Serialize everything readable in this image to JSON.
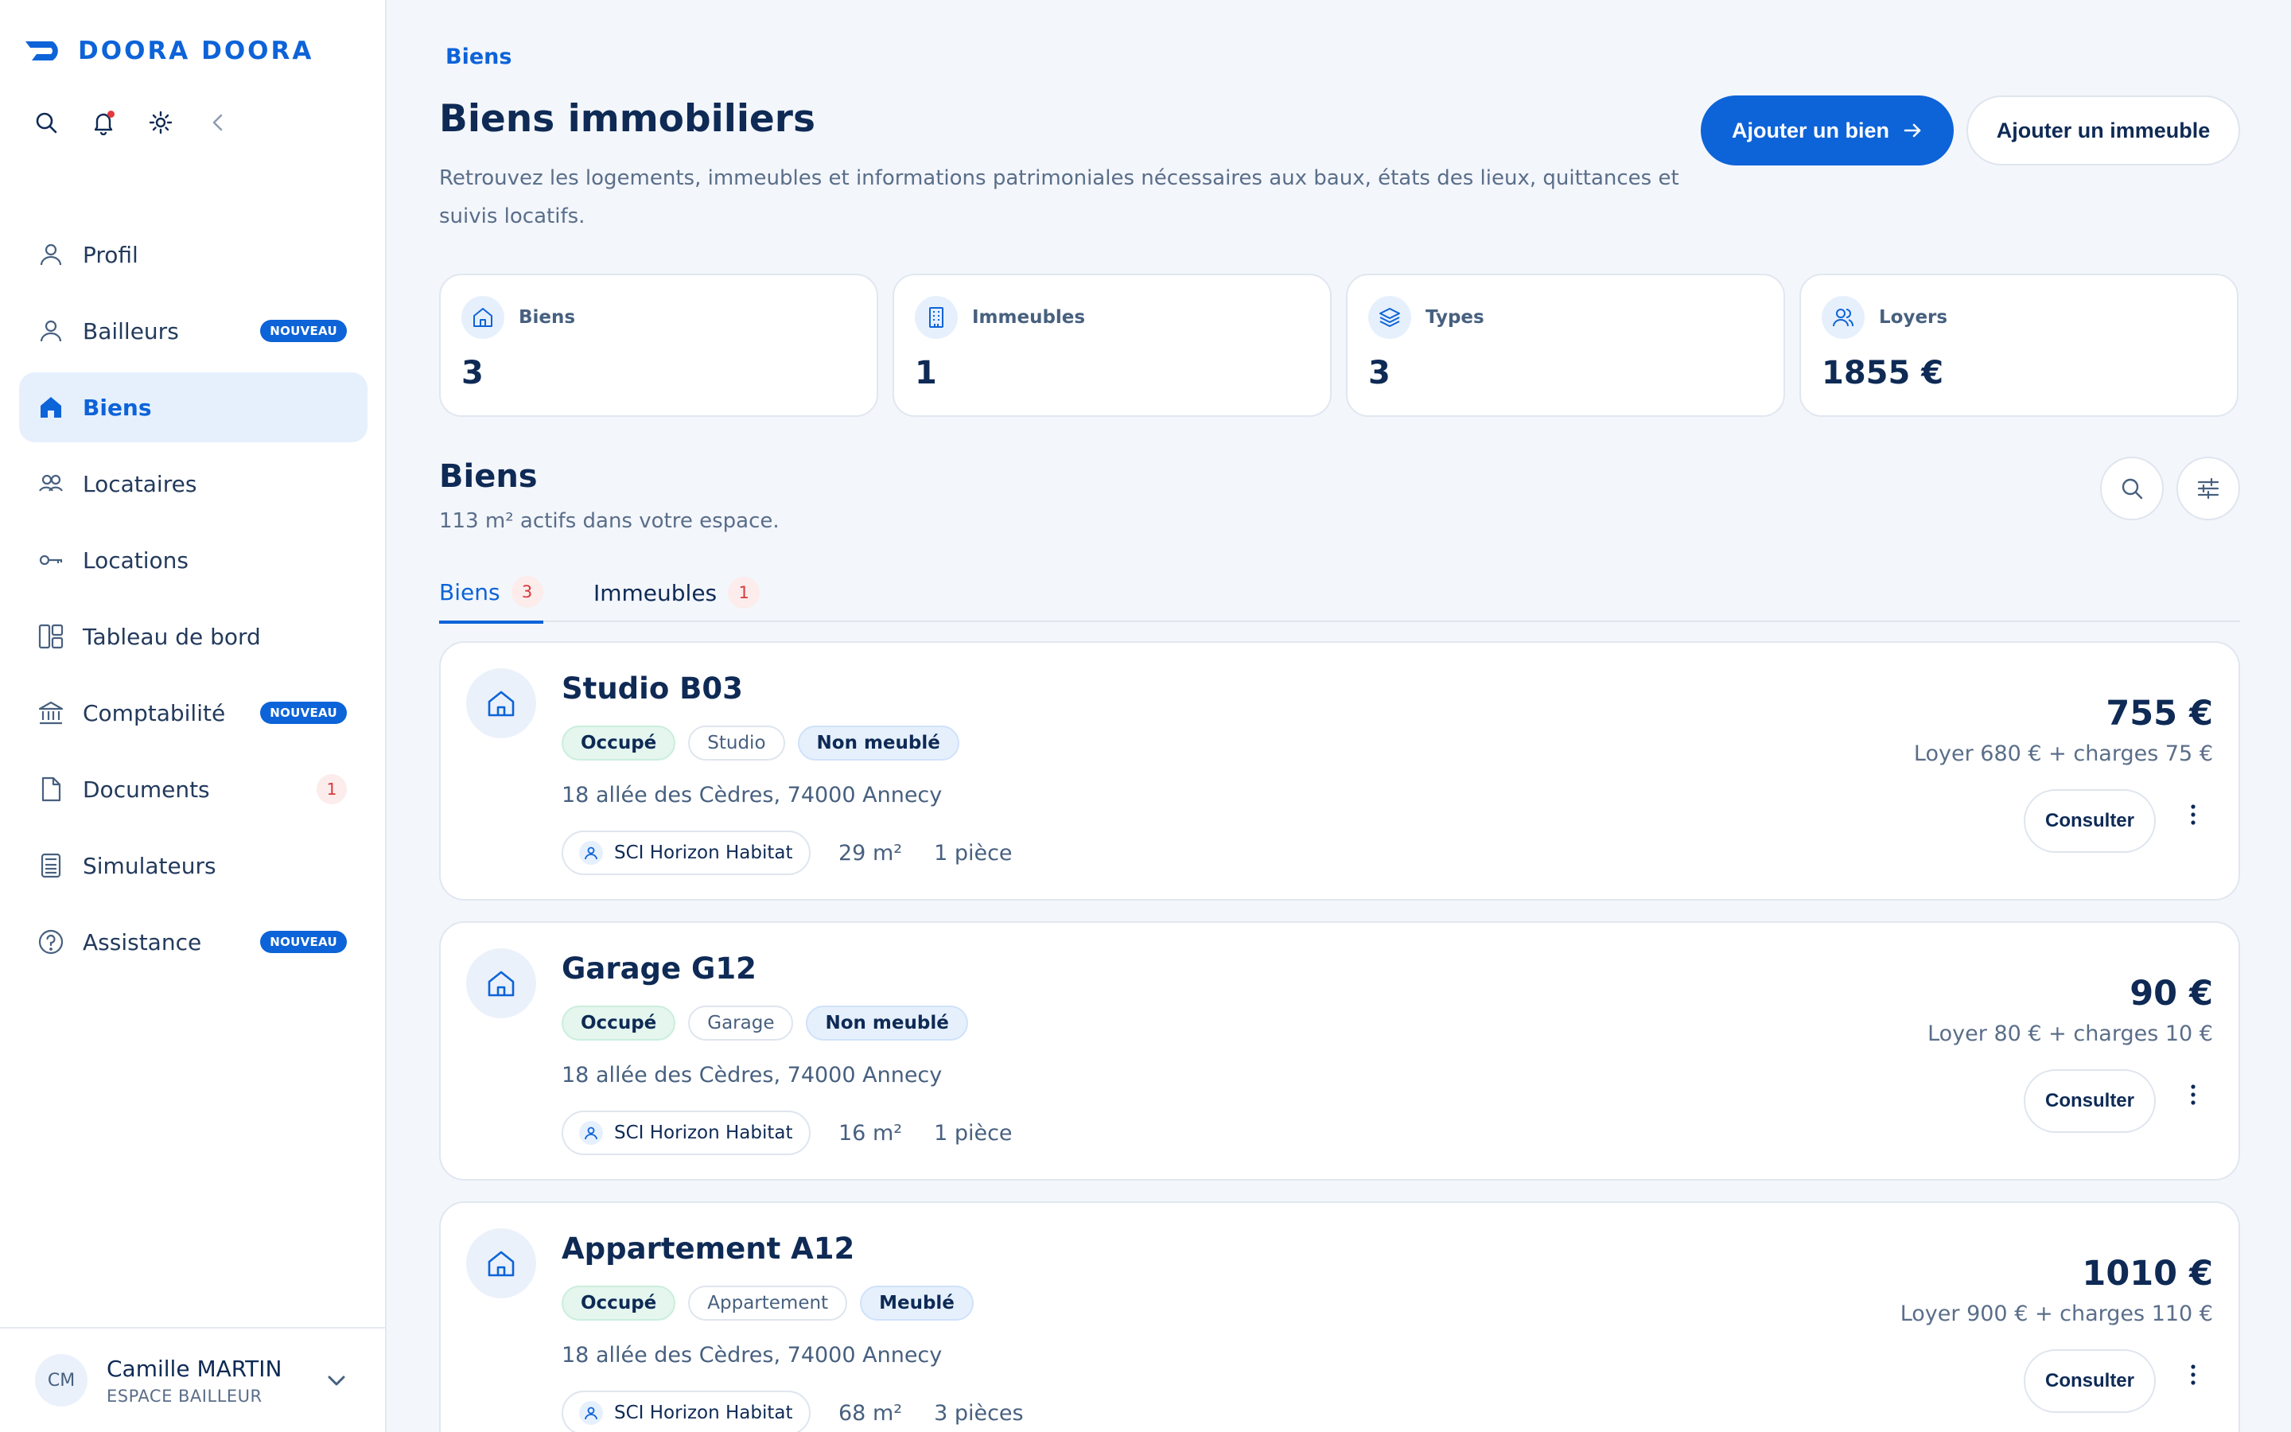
{
  "brand": {
    "name": "DOORA DOORA",
    "accent": "#0d63d8"
  },
  "toolbar": {
    "icons": [
      "search-icon",
      "bell-icon",
      "sun-icon",
      "chevron-left-icon"
    ]
  },
  "nav": {
    "items": [
      {
        "label": "Profil",
        "icon": "user-icon"
      },
      {
        "label": "Bailleurs",
        "icon": "user-icon",
        "badge": "NOUVEAU"
      },
      {
        "label": "Biens",
        "icon": "home-icon",
        "active": true
      },
      {
        "label": "Locataires",
        "icon": "users-icon"
      },
      {
        "label": "Locations",
        "icon": "key-icon"
      },
      {
        "label": "Tableau de bord",
        "icon": "dashboard-icon"
      },
      {
        "label": "Comptabilité",
        "icon": "bank-icon",
        "badge": "NOUVEAU"
      },
      {
        "label": "Documents",
        "icon": "document-icon",
        "count": "1"
      },
      {
        "label": "Simulateurs",
        "icon": "calculator-icon"
      },
      {
        "label": "Assistance",
        "icon": "help-icon",
        "badge": "NOUVEAU"
      }
    ]
  },
  "user": {
    "initials": "CM",
    "name": "Camille MARTIN",
    "role": "ESPACE BAILLEUR"
  },
  "header": {
    "breadcrumb": "Biens",
    "title": "Biens immobiliers",
    "description": "Retrouvez les logements, immeubles et informations patrimoniales nécessaires aux baux, états des lieux, quittances et suivis locatifs.",
    "primary_button": "Ajouter un bien",
    "secondary_button": "Ajouter un immeuble"
  },
  "stats": [
    {
      "label": "Biens",
      "value": "3",
      "icon": "home-icon"
    },
    {
      "label": "Immeubles",
      "value": "1",
      "icon": "building-icon"
    },
    {
      "label": "Types",
      "value": "3",
      "icon": "layers-icon"
    },
    {
      "label": "Loyers",
      "value": "1855 €",
      "icon": "users-icon"
    }
  ],
  "section": {
    "title": "Biens",
    "subtitle": "113 m² actifs dans votre espace.",
    "icons": [
      "search-icon",
      "filter-icon"
    ]
  },
  "tabs": [
    {
      "label": "Biens",
      "count": "3",
      "active": true
    },
    {
      "label": "Immeubles",
      "count": "1"
    }
  ],
  "properties": [
    {
      "title": "Studio B03",
      "status": "Occupé",
      "type": "Studio",
      "furnishing": "Non meublé",
      "address": "18 allée des Cèdres, 74000 Annecy",
      "owner": "SCI Horizon Habitat",
      "surface": "29 m²",
      "rooms": "1 pièce",
      "price": "755 €",
      "detail": "Loyer 680 € + charges 75 €",
      "action": "Consulter"
    },
    {
      "title": "Garage G12",
      "status": "Occupé",
      "type": "Garage",
      "furnishing": "Non meublé",
      "address": "18 allée des Cèdres, 74000 Annecy",
      "owner": "SCI Horizon Habitat",
      "surface": "16 m²",
      "rooms": "1 pièce",
      "price": "90 €",
      "detail": "Loyer 80 € + charges 10 €",
      "action": "Consulter"
    },
    {
      "title": "Appartement A12",
      "status": "Occupé",
      "type": "Appartement",
      "furnishing": "Meublé",
      "address": "18 allée des Cèdres, 74000 Annecy",
      "owner": "SCI Horizon Habitat",
      "surface": "68 m²",
      "rooms": "3 pièces",
      "price": "1010 €",
      "detail": "Loyer 900 € + charges 110 €",
      "action": "Consulter"
    }
  ]
}
